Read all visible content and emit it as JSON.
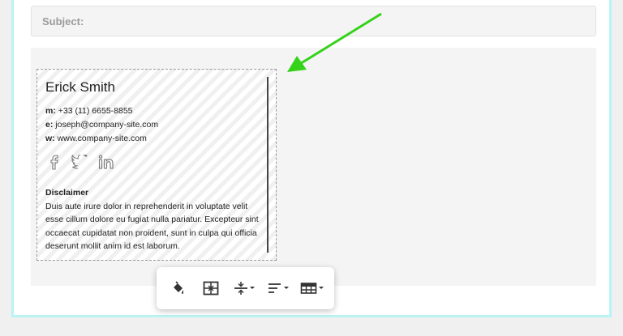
{
  "subject": {
    "label": "Subject:"
  },
  "signature": {
    "name": "Erick Smith",
    "lines": [
      {
        "key": "m:",
        "value": "+33 (11) 6655-8855"
      },
      {
        "key": "e:",
        "value": "joseph@company-site.com"
      },
      {
        "key": "w:",
        "value": "www.company-site.com"
      }
    ],
    "social_icons": [
      "facebook-icon",
      "twitter-icon",
      "linkedin-icon"
    ],
    "disclaimer_title": "Disclaimer",
    "disclaimer_text": "Duis aute irure dolor in reprehenderit in voluptate velit esse cillum dolore eu fugiat nulla pariatur. Excepteur sint occaecat cupidatat non proident, sunt in culpa qui officia deserunt mollit anim id est laborum."
  },
  "toolbar": {
    "buttons": [
      "fill-color-icon",
      "cell-properties-icon",
      "vertical-align-icon",
      "horizontal-align-icon",
      "table-options-icon"
    ]
  },
  "colors": {
    "arrow": "#34d219",
    "frame": "#b9f3f6"
  }
}
